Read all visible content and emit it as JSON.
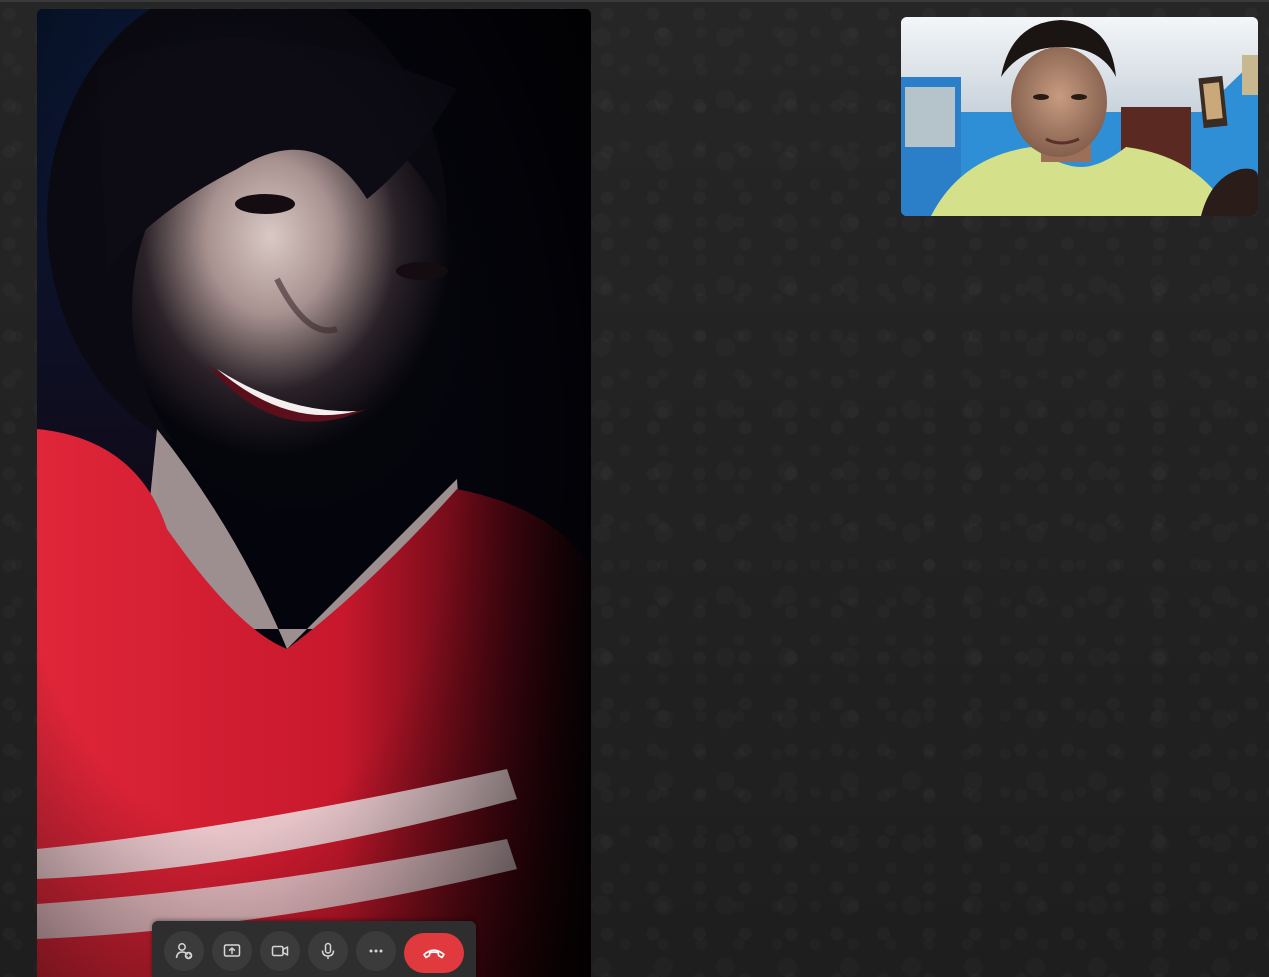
{
  "call": {
    "controls": [
      {
        "id": "add-participant",
        "icon": "add-person-icon",
        "label": ""
      },
      {
        "id": "share-screen",
        "icon": "screen-share-icon",
        "label": ""
      },
      {
        "id": "camera",
        "icon": "video-camera-icon",
        "label": ""
      },
      {
        "id": "microphone",
        "icon": "microphone-icon",
        "label": ""
      },
      {
        "id": "more",
        "icon": "more-options-icon",
        "label": ""
      },
      {
        "id": "end-call",
        "icon": "end-call-icon",
        "label": ""
      }
    ],
    "colors": {
      "background": "#202020",
      "control_bar": "#2e2e2e",
      "control_button": "#3b3b3b",
      "end_call": "#e0393e",
      "icon": "#d6d6d6"
    },
    "remote_video": {
      "icon": "video-feed"
    },
    "self_view": {
      "icon": "video-feed"
    }
  }
}
